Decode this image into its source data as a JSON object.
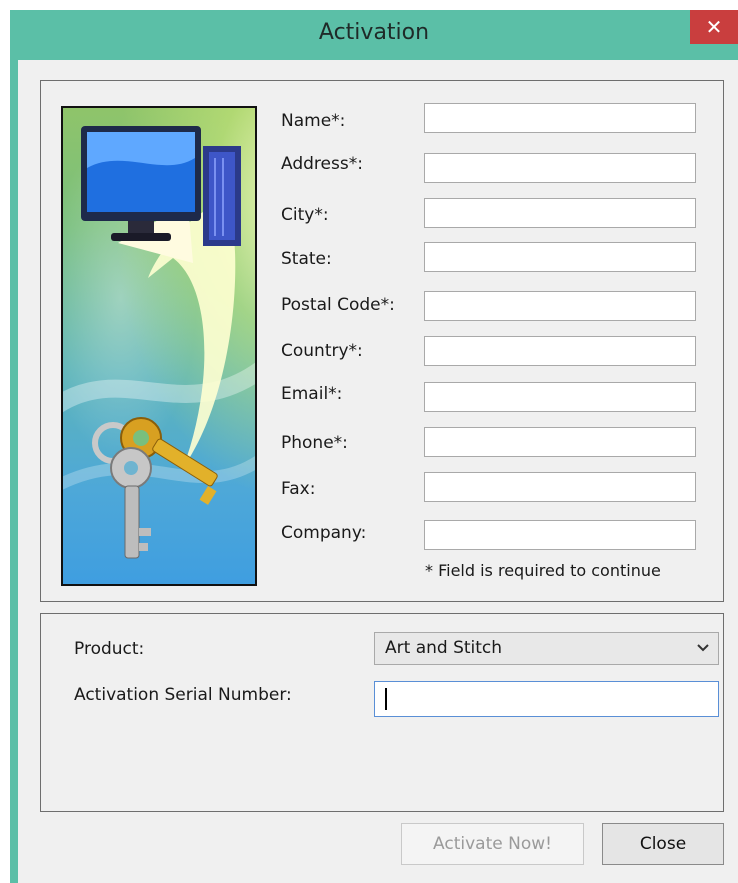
{
  "window": {
    "title": "Activation",
    "close_glyph": "✕"
  },
  "form": {
    "fields": [
      {
        "label": "Name*:",
        "value": ""
      },
      {
        "label": "Address*:",
        "value": ""
      },
      {
        "label": "City*:",
        "value": ""
      },
      {
        "label": "State:",
        "value": ""
      },
      {
        "label": "Postal Code*:",
        "value": ""
      },
      {
        "label": "Country*:",
        "value": ""
      },
      {
        "label": "Email*:",
        "value": ""
      },
      {
        "label": "Phone*:",
        "value": ""
      },
      {
        "label": "Fax:",
        "value": ""
      },
      {
        "label": "Company:",
        "value": ""
      }
    ],
    "required_note": "* Field is required to continue"
  },
  "activation": {
    "product_label": "Product:",
    "product_value": "Art and Stitch",
    "serial_label": "Activation Serial Number:",
    "serial_value": ""
  },
  "buttons": {
    "activate_label": "Activate Now!",
    "close_label": "Close"
  },
  "icons": {
    "illustration": "computer-with-keys-illustration",
    "dropdown": "chevron-down-icon",
    "close": "close-icon"
  },
  "colors": {
    "titlebar": "#5bbfa7",
    "close_button": "#c93e3e",
    "dialog_bg": "#f0f0f0",
    "focus_border": "#5a8fd6"
  }
}
